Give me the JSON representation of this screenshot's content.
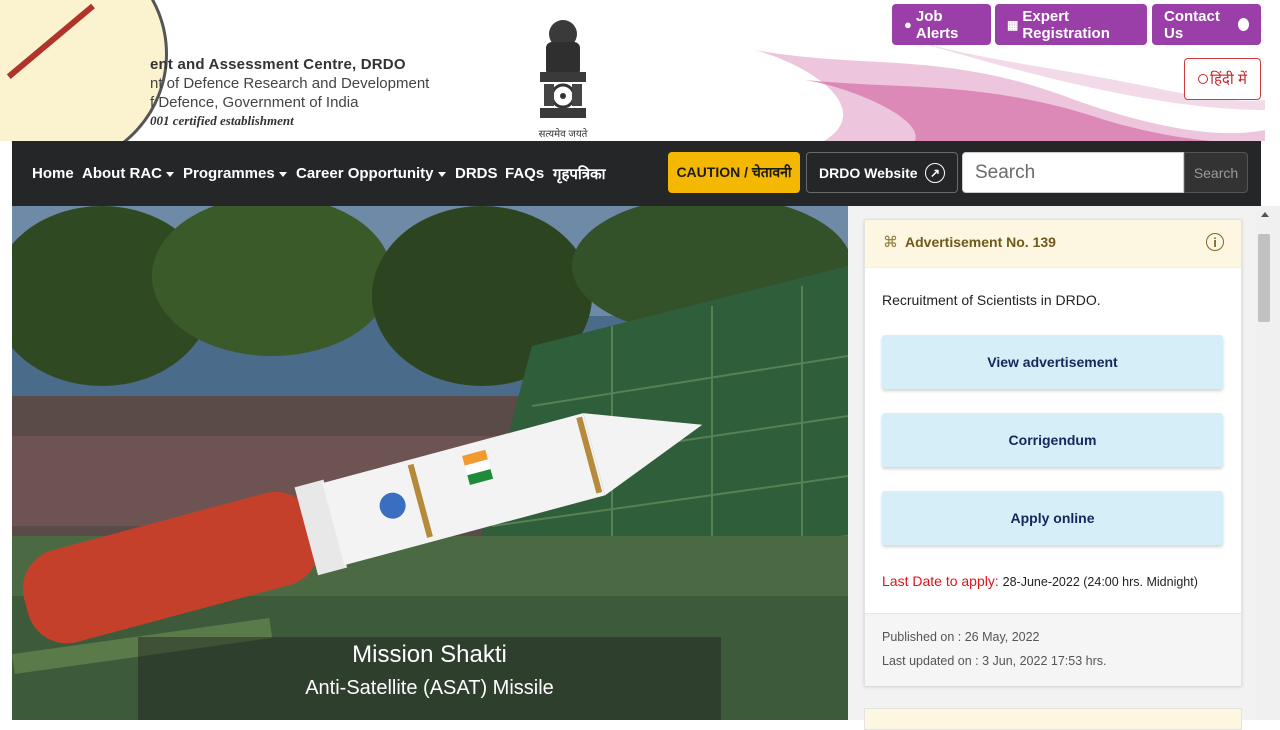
{
  "header": {
    "org_line1": "ent and Assessment Centre, DRDO",
    "org_line2": "nt of Defence Research and Development",
    "org_line3": "f Defence, Government of India",
    "org_line4": "001 certified establishment",
    "emblem_motto": "सत्यमेव जयते",
    "buttons": {
      "job_alerts": "Job Alerts",
      "expert_registration": "Expert Registration",
      "contact_us": "Contact Us",
      "hindi": "हिंदी में"
    }
  },
  "nav": {
    "items": [
      {
        "label": "Home",
        "dropdown": false
      },
      {
        "label": "About RAC",
        "dropdown": true
      },
      {
        "label": "Programmes",
        "dropdown": true
      },
      {
        "label": "Career Opportunity",
        "dropdown": true
      },
      {
        "label": "DRDS",
        "dropdown": false
      },
      {
        "label": "FAQs",
        "dropdown": false
      },
      {
        "label": "गृहपत्रिका",
        "dropdown": false
      }
    ],
    "caution": "CAUTION / चेतावनी",
    "drdo_website": "DRDO Website",
    "search_placeholder": "Search",
    "search_button": "Search"
  },
  "hero": {
    "title": "Mission Shakti",
    "subtitle": "Anti-Satellite (ASAT) Missile"
  },
  "advertisement": {
    "title": "Advertisement No. 139",
    "description": "Recruitment of Scientists in DRDO.",
    "buttons": [
      "View advertisement",
      "Corrigendum",
      "Apply online"
    ],
    "last_date_label": "Last Date to apply:",
    "last_date_value": "28-June-2022 (24:00 hrs. Midnight)",
    "published": "Published on : 26 May, 2022",
    "updated": "Last updated on : 3 Jun, 2022 17:53 hrs."
  },
  "colors": {
    "accent_purple": "#9b3fa8",
    "nav_bg": "#252627",
    "caution_yellow": "#f5b800",
    "ad_button_bg": "#d6eef8",
    "last_date_red": "#e0121a"
  }
}
